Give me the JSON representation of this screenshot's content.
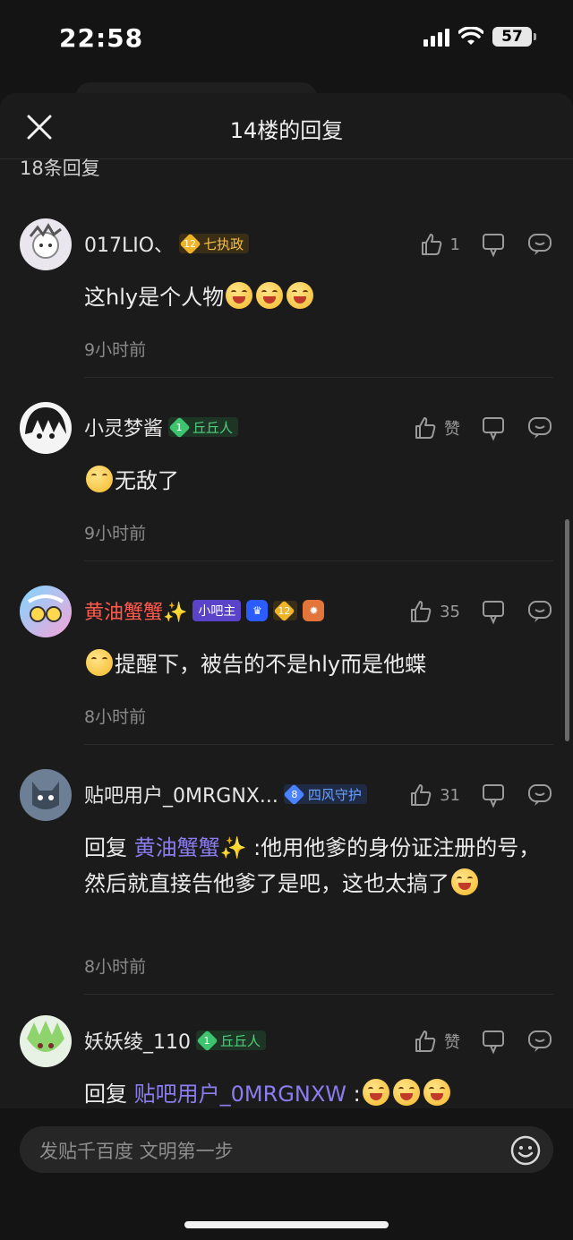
{
  "status": {
    "time": "22:58",
    "battery": "57"
  },
  "sheet": {
    "title": "14楼的回复",
    "reply_count": "18条回复"
  },
  "comments": [
    {
      "username": "017LIO、",
      "level": "12",
      "badge": "七执政",
      "likes": "1",
      "text": "这hly是个人物",
      "time": "9小时前"
    },
    {
      "username": "小灵梦酱",
      "level": "1",
      "badge": "丘丘人",
      "likes": "赞",
      "text": "无敌了",
      "time": "9小时前"
    },
    {
      "username": "黄油蟹蟹✨",
      "role": "小吧主",
      "level": "12",
      "likes": "35",
      "text": "提醒下，被告的不是hly而是他蝶",
      "time": "8小时前"
    },
    {
      "username": "贴吧用户_0MRGNX...",
      "level": "8",
      "badge": "四风守护",
      "likes": "31",
      "reply_prefix": "回复 ",
      "mention": "黄油蟹蟹✨",
      "text": " :他用他爹的身份证注册的号，然后就直接告他爹了是吧，这也太搞了",
      "time": "8小时前"
    },
    {
      "username": "妖妖绫_110",
      "level": "1",
      "badge": "丘丘人",
      "likes": "赞",
      "reply_prefix": "回复 ",
      "mention": "贴吧用户_0MRGNXW",
      "text": " :"
    }
  ],
  "input": {
    "placeholder": "发贴千百度 文明第一步"
  }
}
